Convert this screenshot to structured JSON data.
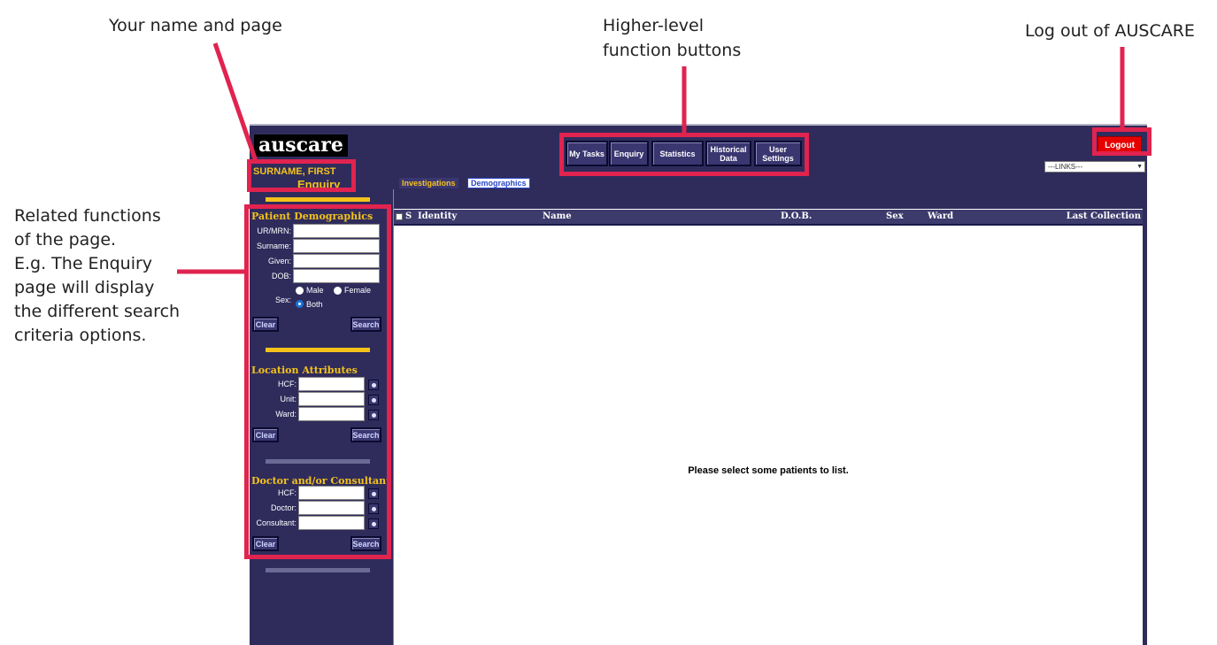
{
  "annotations": {
    "name_page": "Your name and page",
    "higher_level_line1": "Higher-level",
    "higher_level_line2": "function buttons",
    "logout": "Log out of AUSCARE",
    "related_line1": "Related functions",
    "related_line2": "of the page.",
    "related_line3": "E.g. The Enquiry",
    "related_line4": "page will display",
    "related_line5": "the different search",
    "related_line6": "criteria options."
  },
  "app": {
    "logo": "auscare",
    "user_name": "SURNAME, FIRST",
    "page_name": "Enquiry",
    "top_buttons": {
      "my_tasks": "My Tasks",
      "enquiry": "Enquiry",
      "statistics": "Statistics",
      "historical_line1": "Historical",
      "historical_line2": "Data",
      "user_line1": "User",
      "user_line2": "Settings"
    },
    "logout": "Logout",
    "links_select": "---LINKS---"
  },
  "sidebar": {
    "patient": {
      "title": "Patient Demographics",
      "urmrn": "UR/MRN:",
      "surname": "Surname:",
      "given": "Given:",
      "dob": "DOB:",
      "sex": "Sex:",
      "male": "Male",
      "female": "Female",
      "both": "Both",
      "sex_selected": "Both",
      "clear": "Clear",
      "search": "Search"
    },
    "location": {
      "title": "Location Attributes",
      "hcf": "HCF:",
      "unit": "Unit:",
      "ward": "Ward:",
      "clear": "Clear",
      "search": "Search"
    },
    "doctor": {
      "title": "Doctor and/or Consultant",
      "hcf": "HCF:",
      "doctor": "Doctor:",
      "consultant": "Consultant:",
      "clear": "Clear",
      "search": "Search"
    }
  },
  "main": {
    "tabs": [
      "Investigations",
      "Demographics"
    ],
    "active_tab": "Investigations",
    "columns": {
      "s": "S",
      "identity": "Identity",
      "name": "Name",
      "dob": "D.O.B.",
      "sex": "Sex",
      "ward": "Ward",
      "last_collection": "Last Collection"
    },
    "empty_message": "Please select some patients to list."
  },
  "colors": {
    "annotation_red": "#e0234f",
    "app_bg": "#2f2c5c",
    "accent_yellow": "#f5c21b",
    "logout_red": "#e60000"
  }
}
